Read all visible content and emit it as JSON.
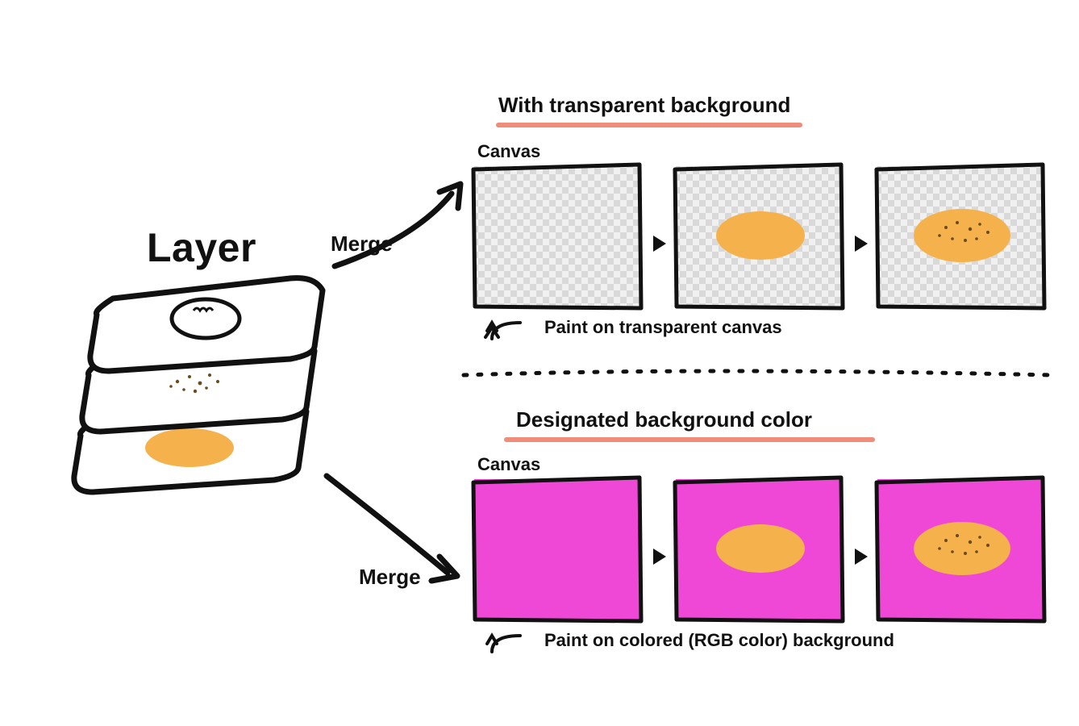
{
  "leftTitle": "Layer",
  "mergeTop": "Merge",
  "mergeBottom": "Merge",
  "topHeading": "With transparent background",
  "topCanvasLabel": "Canvas",
  "topNote": "Paint on transparent canvas",
  "bottomHeading": "Designated background color",
  "bottomCanvasLabel": "Canvas",
  "bottomNote": "Paint on colored (RGB color) background",
  "colors": {
    "orange": "#f5b14b",
    "magenta": "#ef48d7",
    "underline": "#f08c7a",
    "speckle": "#6b4a1e"
  }
}
